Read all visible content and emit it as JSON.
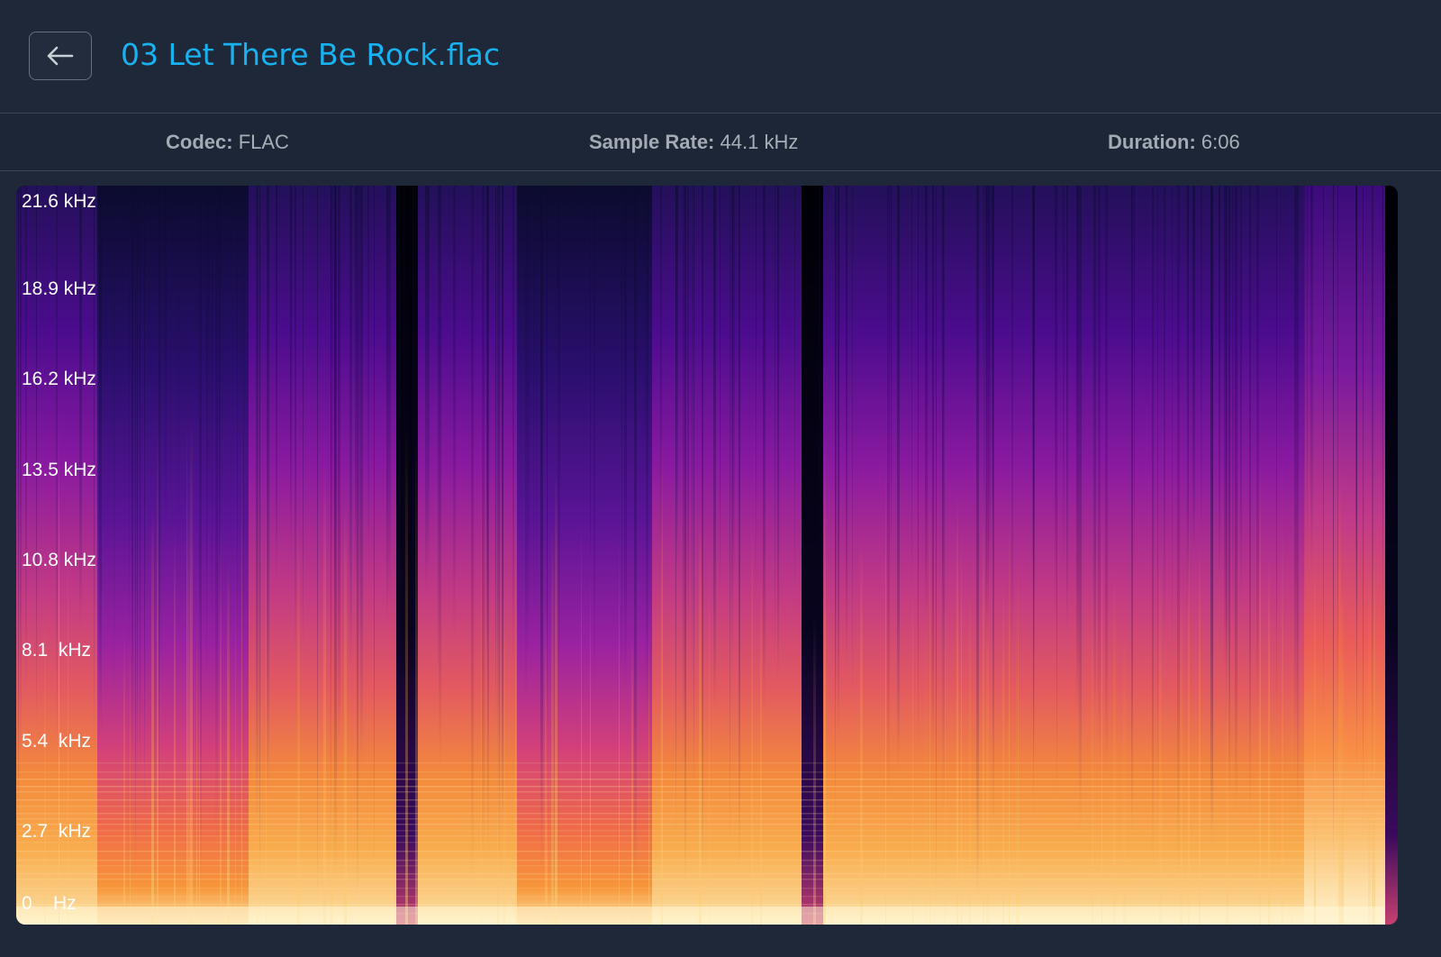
{
  "header": {
    "back_icon": "arrow-left-icon",
    "title": "03 Let There Be Rock.flac"
  },
  "info": {
    "codec_label": "Codec:",
    "codec_value": "FLAC",
    "sample_rate_label": "Sample Rate:",
    "sample_rate_value": "44.1 kHz",
    "duration_label": "Duration:",
    "duration_value": "6:06"
  },
  "spectrogram": {
    "y_labels": [
      "21.6 kHz",
      "18.9 kHz",
      "16.2 kHz",
      "13.5 kHz",
      "10.8 kHz",
      "8.1  kHz",
      "5.4  kHz",
      "2.7  kHz",
      "0    Hz"
    ],
    "colormap": [
      "#000004",
      "#1b0c41",
      "#4a0c6b",
      "#781c6d",
      "#a52c60",
      "#cf4446",
      "#ed6925",
      "#fb9b06",
      "#f7d13d",
      "#fcffa4"
    ]
  }
}
